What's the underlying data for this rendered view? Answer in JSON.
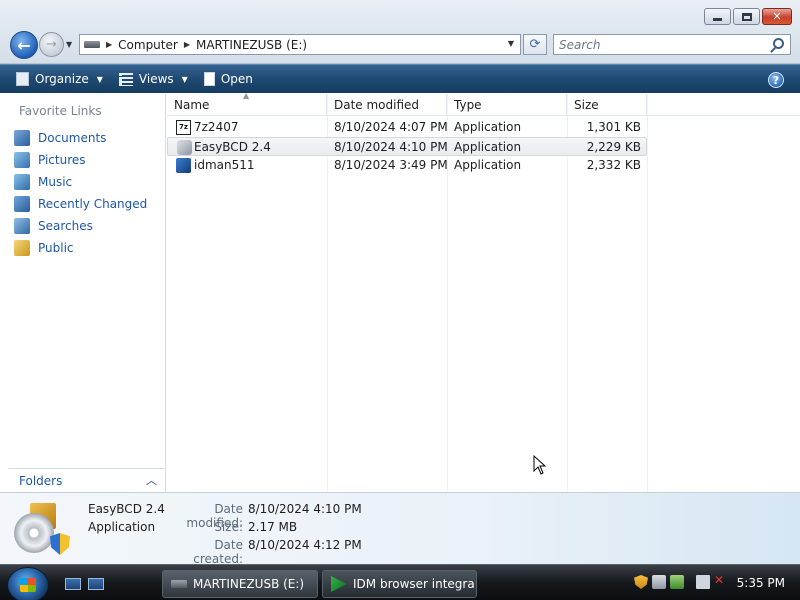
{
  "window": {
    "address": {
      "segments": [
        "Computer",
        "MARTINEZUSB (E:)"
      ]
    },
    "search": {
      "placeholder": "Search"
    },
    "caption": {
      "minimize": "minimize",
      "maximize": "maximize",
      "close": "close"
    }
  },
  "toolbar": {
    "organize_label": "Organize",
    "views_label": "Views",
    "open_label": "Open",
    "help_label": "?"
  },
  "navpane": {
    "heading": "Favorite Links",
    "items": [
      {
        "label": "Documents",
        "icon": "documents-icon"
      },
      {
        "label": "Pictures",
        "icon": "pictures-icon"
      },
      {
        "label": "Music",
        "icon": "music-icon"
      },
      {
        "label": "Recently Changed",
        "icon": "recently-changed-icon"
      },
      {
        "label": "Searches",
        "icon": "searches-icon"
      },
      {
        "label": "Public",
        "icon": "public-folder-icon"
      }
    ],
    "folders_label": "Folders"
  },
  "filelist": {
    "columns": [
      "Name",
      "Date modified",
      "Type",
      "Size"
    ],
    "rows": [
      {
        "name": "7z2407",
        "date": "8/10/2024 4:07 PM",
        "type": "Application",
        "size": "1,301 KB",
        "icon": "7zip-icon"
      },
      {
        "name": "EasyBCD 2.4",
        "date": "8/10/2024 4:10 PM",
        "type": "Application",
        "size": "2,229 KB",
        "icon": "easybcd-icon"
      },
      {
        "name": "idman511",
        "date": "8/10/2024 3:49 PM",
        "type": "Application",
        "size": "2,332 KB",
        "icon": "idm-icon"
      }
    ],
    "selected_row": 1
  },
  "details": {
    "name": "EasyBCD 2.4",
    "type": "Application",
    "date_modified_label": "Date modified:",
    "date_modified": "8/10/2024 4:10 PM",
    "size_label": "Size:",
    "size": "2.17 MB",
    "date_created_label": "Date created:",
    "date_created": "8/10/2024 4:12 PM"
  },
  "taskbar": {
    "buttons": [
      {
        "label": "MARTINEZUSB (E:)",
        "icon": "drive-icon"
      },
      {
        "label": "IDM browser integra...",
        "icon": "idm-icon"
      }
    ],
    "clock": "5:35 PM"
  }
}
